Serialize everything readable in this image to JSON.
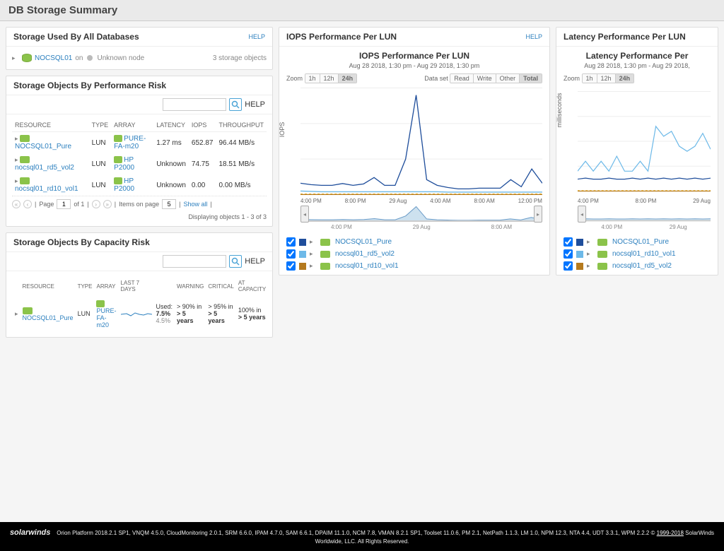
{
  "page_title": "DB Storage Summary",
  "help_label": "HELP",
  "storage_all": {
    "title": "Storage Used By All Databases",
    "node": "NOCSQL01",
    "on_label": "on",
    "unknown_label": "Unknown node",
    "objects_count": "3 storage objects"
  },
  "perf_risk": {
    "title": "Storage Objects By Performance Risk",
    "columns": {
      "resource": "RESOURCE",
      "type": "TYPE",
      "array": "ARRAY",
      "latency": "LATENCY",
      "iops": "IOPS",
      "throughput": "THROUGHPUT"
    },
    "rows": [
      {
        "resource": "NOCSQL01_Pure",
        "type": "LUN",
        "array": "PURE-FA-m20",
        "latency": "1.27 ms",
        "iops": "652.87",
        "throughput": "96.44 MB/s"
      },
      {
        "resource": "nocsql01_rd5_vol2",
        "type": "LUN",
        "array": "HP P2000",
        "latency": "Unknown",
        "iops": "74.75",
        "throughput": "18.51 MB/s"
      },
      {
        "resource": "nocsql01_rd10_vol1",
        "type": "LUN",
        "array": "HP P2000",
        "latency": "Unknown",
        "iops": "0.00",
        "throughput": "0.00 MB/s"
      }
    ],
    "pager": {
      "page_label": "Page",
      "page_val": "1",
      "of_label": "of 1",
      "items_label": "Items on page",
      "items_val": "5",
      "show_all": "Show all"
    },
    "displaying": "Displaying objects 1 - 3 of 3"
  },
  "cap_risk": {
    "title": "Storage Objects By Capacity Risk",
    "columns": {
      "resource": "RESOURCE",
      "type": "TYPE",
      "array": "ARRAY",
      "last7": "LAST 7 DAYS",
      "warning": "WARNING",
      "critical": "CRITICAL",
      "atcap": "AT CAPACITY"
    },
    "row": {
      "resource": "NOCSQL01_Pure",
      "type": "LUN",
      "array": "PURE-FA-m20",
      "used_label": "Used:",
      "used_val": "7.5%",
      "used_sub": "4.5%",
      "warning": "> 90% in",
      "warning2": "> 5 years",
      "critical": "> 95% in",
      "critical2": "> 5 years",
      "atcap": "100% in",
      "atcap2": "> 5 years"
    }
  },
  "iops_chart": {
    "panel_title": "IOPS Performance Per LUN",
    "chart_title": "IOPS Performance Per LUN",
    "chart_sub": "Aug 28 2018, 1:30 pm - Aug 29 2018, 1:30 pm",
    "zoom_label": "Zoom",
    "zoom_opts": [
      "1h",
      "12h",
      "24h"
    ],
    "zoom_active": "24h",
    "dataset_label": "Data set",
    "dataset_opts": [
      "Read",
      "Write",
      "Other",
      "Total"
    ],
    "dataset_active": "Total",
    "ylabel": "IOPS",
    "legend": [
      {
        "name": "NOCSQL01_Pure",
        "color": "#1f4e9b"
      },
      {
        "name": "nocsql01_rd5_vol2",
        "color": "#6db9e8"
      },
      {
        "name": "nocsql01_rd10_vol1",
        "color": "#b57a1e"
      }
    ],
    "xlabels": [
      "4:00 PM",
      "8:00 PM",
      "29 Aug",
      "4:00 AM",
      "8:00 AM",
      "12:00 PM"
    ],
    "nav_labels": [
      "4:00 PM",
      "29 Aug",
      "8:00 AM"
    ]
  },
  "latency_chart": {
    "panel_title": "Latency Performance Per LUN",
    "chart_title": "Latency Performance Per",
    "chart_sub": "Aug 28 2018, 1:30 pm - Aug 29 2018,",
    "zoom_label": "Zoom",
    "zoom_opts": [
      "1h",
      "12h",
      "24h"
    ],
    "zoom_active": "24h",
    "ylabel": "milliseconds",
    "legend": [
      {
        "name": "NOCSQL01_Pure",
        "color": "#1f4e9b"
      },
      {
        "name": "nocsql01_rd10_vol1",
        "color": "#6db9e8"
      },
      {
        "name": "nocsql01_rd5_vol2",
        "color": "#b57a1e"
      }
    ],
    "xlabels": [
      "4:00 PM",
      "8:00 PM",
      "29 Aug"
    ]
  },
  "chart_data": [
    {
      "type": "line",
      "title": "IOPS Performance Per LUN",
      "ylabel": "IOPS",
      "ylim": [
        0,
        3000
      ],
      "yticks": [
        0,
        1000,
        2000,
        3000
      ],
      "categories": [
        "4:00 PM",
        "8:00 PM",
        "29 Aug",
        "4:00 AM",
        "8:00 AM",
        "12:00 PM"
      ],
      "series": [
        {
          "name": "NOCSQL01_Pure",
          "color": "#1f4e9b",
          "values": [
            320,
            280,
            260,
            260,
            310,
            260,
            300,
            480,
            260,
            260,
            1000,
            2800,
            420,
            260,
            200,
            160,
            160,
            180,
            180,
            180,
            420,
            220,
            720,
            320
          ]
        },
        {
          "name": "nocsql01_rd5_vol2",
          "color": "#6db9e8",
          "values": [
            100,
            90,
            80,
            80,
            80,
            80,
            80,
            80,
            80,
            80,
            80,
            80,
            80,
            80,
            70,
            70,
            70,
            70,
            70,
            70,
            70,
            70,
            70,
            70
          ]
        },
        {
          "name": "nocsql01_rd10_vol1",
          "color": "#b57a1e",
          "values": [
            0,
            0,
            0,
            0,
            0,
            0,
            0,
            0,
            0,
            0,
            0,
            0,
            0,
            0,
            0,
            0,
            0,
            0,
            0,
            0,
            0,
            0,
            0,
            0
          ]
        }
      ]
    },
    {
      "type": "line",
      "title": "Latency Performance Per LUN",
      "ylabel": "milliseconds",
      "ylim": [
        0,
        10
      ],
      "yticks": [
        0,
        2.5,
        5,
        7.5,
        10
      ],
      "categories": [
        "4:00 PM",
        "8:00 PM",
        "29 Aug"
      ],
      "series": [
        {
          "name": "NOCSQL01_Pure",
          "color": "#1f4e9b",
          "values": [
            1.2,
            1.3,
            1.2,
            1.2,
            1.3,
            1.2,
            1.2,
            1.3,
            1.2,
            1.3,
            1.2,
            1.3,
            1.2,
            1.3,
            1.2,
            1.3,
            1.2,
            1.3
          ]
        },
        {
          "name": "nocsql01_rd10_vol1",
          "color": "#6db9e8",
          "values": [
            2,
            3,
            2,
            3,
            2,
            3.5,
            2,
            2,
            3,
            2,
            6.5,
            5.5,
            6,
            4.5,
            4,
            4.5,
            5.8,
            4.2
          ]
        },
        {
          "name": "nocsql01_rd5_vol2",
          "color": "#b57a1e",
          "values": [
            0,
            0,
            0,
            0,
            0,
            0,
            0,
            0,
            0,
            0,
            0,
            0,
            0,
            0,
            0,
            0,
            0,
            0
          ]
        }
      ]
    }
  ],
  "footer": {
    "brand": "solarwinds",
    "text": "Orion Platform 2018.2.1 SP1, VNQM 4.5.0, CloudMonitoring 2.0.1, SRM 6.6.0, IPAM 4.7.0, SAM 6.6.1, DPAIM 11.1.0, NCM 7.8, VMAN 8.2.1 SP1, Toolset 11.0.6, PM 2.1, NetPath 1.1.3, LM 1.0, NPM 12.3, NTA 4.4, UDT 3.3.1, WPM 2.2.2 © ",
    "link": "1999-2018",
    "text2": " SolarWinds Worldwide, LLC. All Rights Reserved."
  }
}
